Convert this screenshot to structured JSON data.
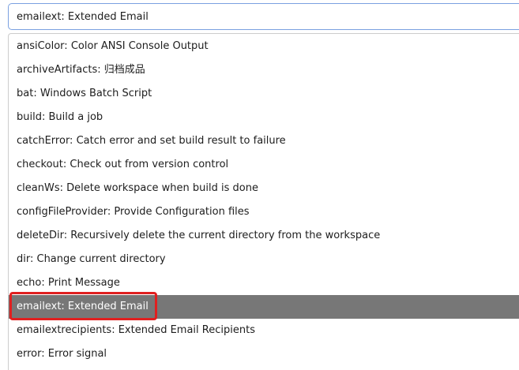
{
  "select": {
    "value": "emailext: Extended Email"
  },
  "dropdown": {
    "options": [
      "ansiColor: Color ANSI Console Output",
      "archiveArtifacts: 归档成品",
      "bat: Windows Batch Script",
      "build: Build a job",
      "catchError: Catch error and set build result to failure",
      "checkout: Check out from version control",
      "cleanWs: Delete workspace when build is done",
      "configFileProvider: Provide Configuration files",
      "deleteDir: Recursively delete the current directory from the workspace",
      "dir: Change current directory",
      "echo: Print Message",
      "emailext: Extended Email",
      "emailextrecipients: Extended Email Recipients",
      "error: Error signal"
    ],
    "selected_index": 11
  },
  "colors": {
    "selected_background": "#777777",
    "selected_text": "#ffffff",
    "annotation_border": "#e02020",
    "focus_border": "#7aa0e0"
  }
}
